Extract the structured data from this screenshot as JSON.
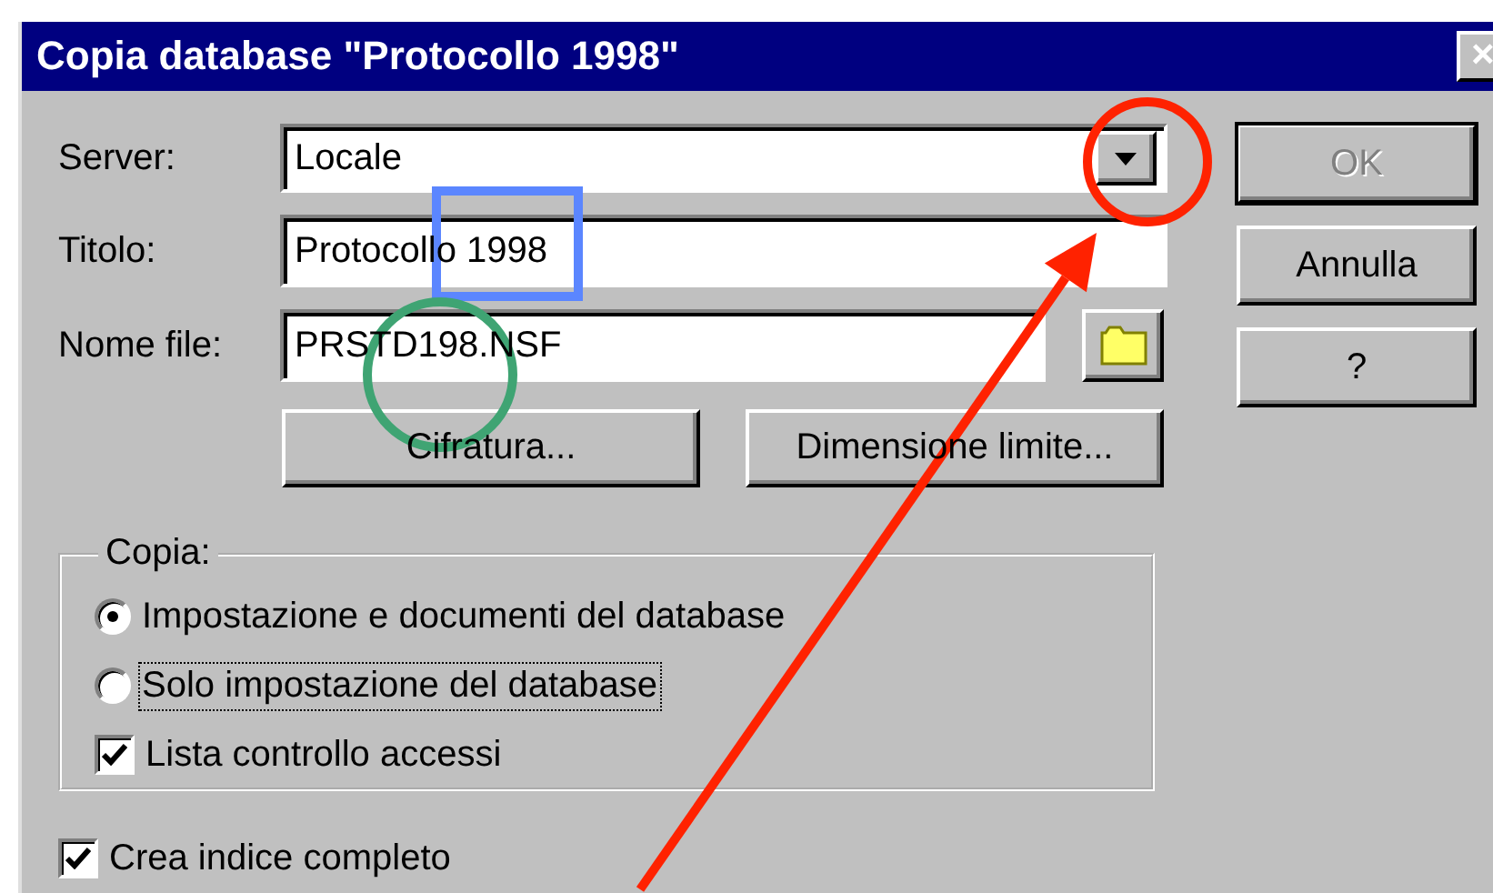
{
  "window": {
    "title": "Copia database \"Protocollo 1998\"",
    "close_symbol": "×"
  },
  "fields": [
    {
      "kind": "combo",
      "label": "Server:",
      "value": "Locale"
    },
    {
      "kind": "text",
      "label": "Titolo:",
      "value": "Protocollo 1998"
    },
    {
      "kind": "file",
      "label": "Nome file:",
      "value": "PRSTD198.NSF"
    }
  ],
  "option_buttons": [
    {
      "label": "Cifratura..."
    },
    {
      "label": "Dimensione limite..."
    }
  ],
  "dialog_buttons": [
    {
      "label": "OK",
      "disabled": true,
      "default": true
    },
    {
      "label": "Annulla",
      "disabled": false,
      "default": false
    },
    {
      "label": "?",
      "disabled": false,
      "default": false
    }
  ],
  "copy_group": {
    "title": "Copia:",
    "items": [
      {
        "kind": "radio",
        "label": "Impostazione e documenti del database",
        "selected": true,
        "focused": false
      },
      {
        "kind": "radio",
        "label": "Solo impostazione del database",
        "selected": false,
        "focused": true
      },
      {
        "kind": "checkbox",
        "label": "Lista controllo accessi",
        "checked": true
      }
    ]
  },
  "full_index": {
    "label": "Crea indice completo",
    "checked": true
  },
  "annotations": [
    {
      "kind": "circle",
      "color": "#ff2200"
    },
    {
      "kind": "arrow",
      "color": "#ff2200"
    },
    {
      "kind": "rectangle",
      "color": "#5b86ff"
    },
    {
      "kind": "circle",
      "color": "#3fa473"
    }
  ]
}
